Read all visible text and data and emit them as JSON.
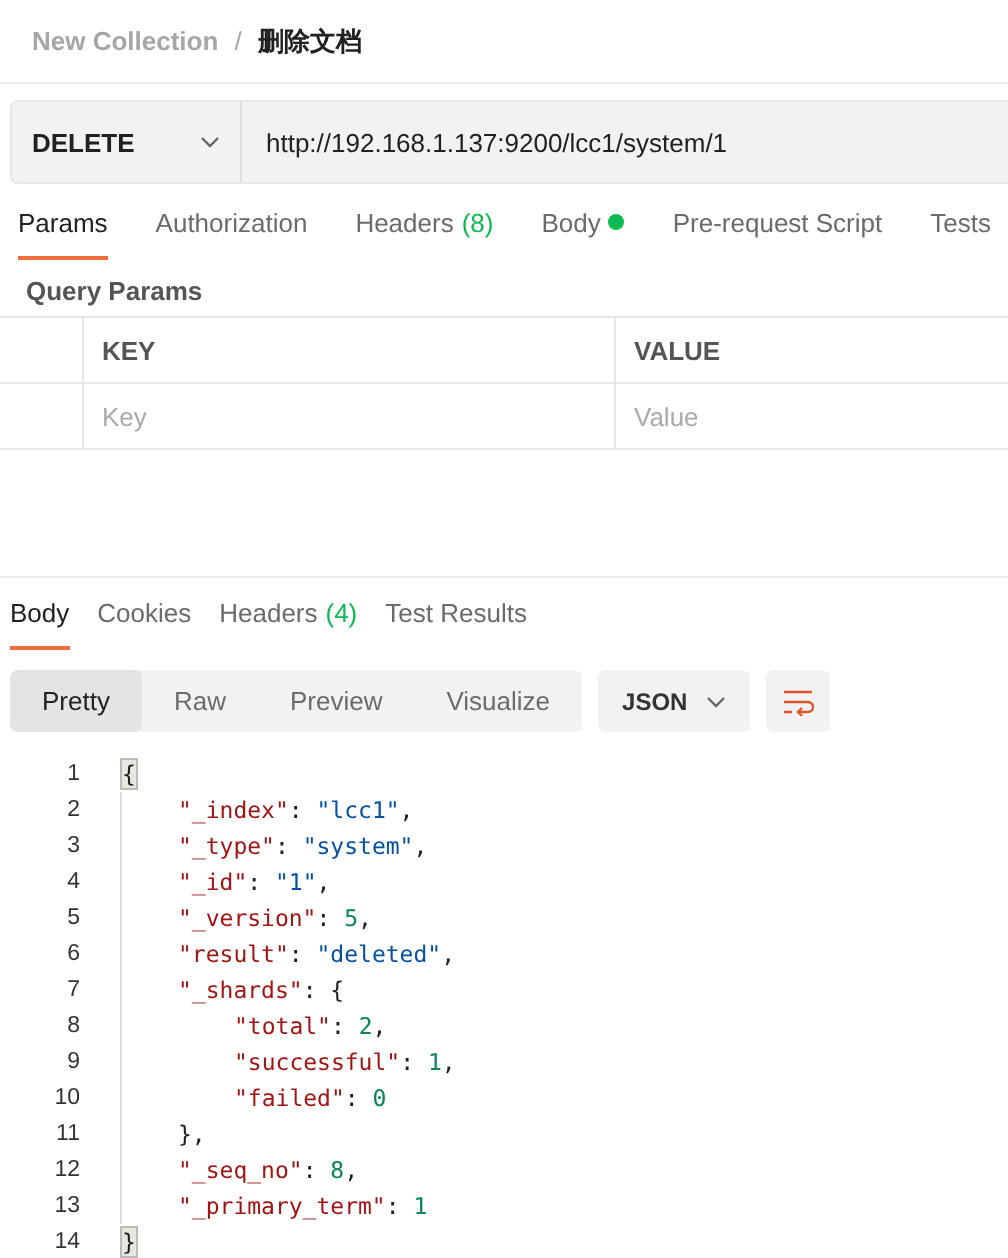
{
  "breadcrumb": {
    "collection": "New Collection",
    "separator": "/",
    "request": "删除文档"
  },
  "request": {
    "method": "DELETE",
    "url": "http://192.168.1.137:9200/lcc1/system/1"
  },
  "request_tabs": [
    {
      "label": "Params",
      "selected": true
    },
    {
      "label": "Authorization",
      "selected": false
    },
    {
      "label": "Headers",
      "count": "(8)",
      "selected": false
    },
    {
      "label": "Body",
      "has_content": true,
      "selected": false
    },
    {
      "label": "Pre-request Script",
      "selected": false
    },
    {
      "label": "Tests",
      "selected": false
    }
  ],
  "query_params": {
    "title": "Query Params",
    "columns": [
      "KEY",
      "VALUE"
    ],
    "placeholders": [
      "Key",
      "Value"
    ]
  },
  "response_tabs": [
    {
      "label": "Body",
      "selected": true
    },
    {
      "label": "Cookies",
      "selected": false
    },
    {
      "label": "Headers",
      "count": "(4)",
      "selected": false
    },
    {
      "label": "Test Results",
      "selected": false
    }
  ],
  "view_modes": [
    {
      "label": "Pretty",
      "selected": true
    },
    {
      "label": "Raw",
      "selected": false
    },
    {
      "label": "Preview",
      "selected": false
    },
    {
      "label": "Visualize",
      "selected": false
    }
  ],
  "format": "JSON",
  "code_lines": [
    {
      "number": "1",
      "tokens": [
        {
          "kind": "bracket",
          "text": "{"
        }
      ],
      "children": [
        {
          "number": "2",
          "tokens": [
            {
              "kind": "key",
              "text": "\"_index\""
            },
            {
              "kind": "punct",
              "text": ": "
            },
            {
              "kind": "string",
              "text": "\"lcc1\""
            },
            {
              "kind": "punct",
              "text": ","
            }
          ]
        },
        {
          "number": "3",
          "tokens": [
            {
              "kind": "key",
              "text": "\"_type\""
            },
            {
              "kind": "punct",
              "text": ": "
            },
            {
              "kind": "string",
              "text": "\"system\""
            },
            {
              "kind": "punct",
              "text": ","
            }
          ]
        },
        {
          "number": "4",
          "tokens": [
            {
              "kind": "key",
              "text": "\"_id\""
            },
            {
              "kind": "punct",
              "text": ": "
            },
            {
              "kind": "string",
              "text": "\"1\""
            },
            {
              "kind": "punct",
              "text": ","
            }
          ]
        },
        {
          "number": "5",
          "tokens": [
            {
              "kind": "key",
              "text": "\"_version\""
            },
            {
              "kind": "punct",
              "text": ": "
            },
            {
              "kind": "number",
              "text": "5"
            },
            {
              "kind": "punct",
              "text": ","
            }
          ]
        },
        {
          "number": "6",
          "tokens": [
            {
              "kind": "key",
              "text": "\"result\""
            },
            {
              "kind": "punct",
              "text": ": "
            },
            {
              "kind": "string",
              "text": "\"deleted\""
            },
            {
              "kind": "punct",
              "text": ","
            }
          ]
        },
        {
          "number": "7",
          "tokens": [
            {
              "kind": "key",
              "text": "\"_shards\""
            },
            {
              "kind": "punct",
              "text": ": {"
            }
          ],
          "children": [
            {
              "number": "8",
              "tokens": [
                {
                  "kind": "key",
                  "text": "\"total\""
                },
                {
                  "kind": "punct",
                  "text": ": "
                },
                {
                  "kind": "number",
                  "text": "2"
                },
                {
                  "kind": "punct",
                  "text": ","
                }
              ]
            },
            {
              "number": "9",
              "tokens": [
                {
                  "kind": "key",
                  "text": "\"successful\""
                },
                {
                  "kind": "punct",
                  "text": ": "
                },
                {
                  "kind": "number",
                  "text": "1"
                },
                {
                  "kind": "punct",
                  "text": ","
                }
              ]
            },
            {
              "number": "10",
              "tokens": [
                {
                  "kind": "key",
                  "text": "\"failed\""
                },
                {
                  "kind": "punct",
                  "text": ": "
                },
                {
                  "kind": "number",
                  "text": "0"
                }
              ]
            }
          ]
        },
        {
          "number": "11",
          "tokens": [
            {
              "kind": "punct",
              "text": "},"
            }
          ]
        },
        {
          "number": "12",
          "tokens": [
            {
              "kind": "key",
              "text": "\"_seq_no\""
            },
            {
              "kind": "punct",
              "text": ": "
            },
            {
              "kind": "number",
              "text": "8"
            },
            {
              "kind": "punct",
              "text": ","
            }
          ]
        },
        {
          "number": "13",
          "tokens": [
            {
              "kind": "key",
              "text": "\"_primary_term\""
            },
            {
              "kind": "punct",
              "text": ": "
            },
            {
              "kind": "number",
              "text": "1"
            }
          ]
        }
      ]
    },
    {
      "number": "14",
      "tokens": [
        {
          "kind": "bracket",
          "text": "}"
        }
      ]
    }
  ]
}
